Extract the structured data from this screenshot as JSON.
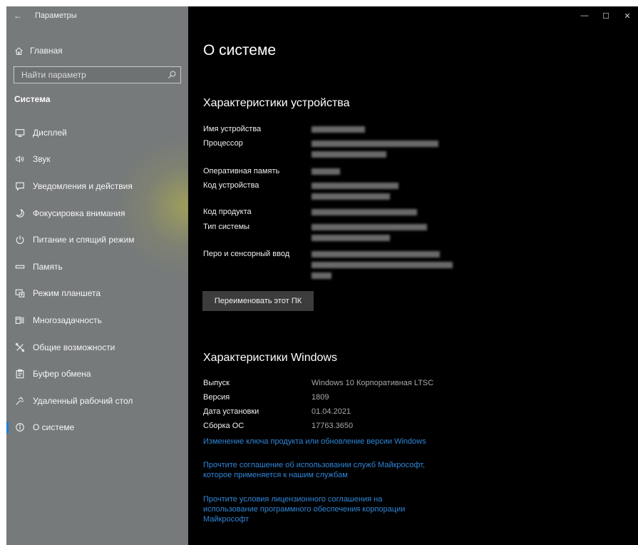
{
  "window": {
    "title": "Параметры",
    "controls": [
      "minimize",
      "maximize",
      "close"
    ]
  },
  "sidebar": {
    "home_label": "Главная",
    "search_placeholder": "Найти параметр",
    "section_title": "Система",
    "items": [
      {
        "label": "Дисплей",
        "icon": "display-icon"
      },
      {
        "label": "Звук",
        "icon": "sound-icon"
      },
      {
        "label": "Уведомления и действия",
        "icon": "notifications-icon"
      },
      {
        "label": "Фокусировка внимания",
        "icon": "focus-moon-icon"
      },
      {
        "label": "Питание и спящий режим",
        "icon": "power-icon"
      },
      {
        "label": "Память",
        "icon": "storage-icon"
      },
      {
        "label": "Режим планшета",
        "icon": "tablet-mode-icon"
      },
      {
        "label": "Многозадачность",
        "icon": "multitasking-icon"
      },
      {
        "label": "Общие возможности",
        "icon": "shared-experiences-icon"
      },
      {
        "label": "Буфер обмена",
        "icon": "clipboard-icon"
      },
      {
        "label": "Удаленный рабочий стол",
        "icon": "remote-desktop-icon"
      },
      {
        "label": "О системе",
        "icon": "info-icon",
        "active": true
      }
    ]
  },
  "main": {
    "page_title": "О системе",
    "device_specs": {
      "heading": "Характеристики устройства",
      "labels": {
        "device_name": "Имя устройства",
        "processor": "Процессор",
        "ram": "Оперативная память",
        "device_id": "Код устройства",
        "product_id": "Код продукта",
        "system_type": "Тип системы",
        "pen_touch": "Перо и сенсорный ввод"
      },
      "rename_button": "Переименовать этот ПК"
    },
    "windows_specs": {
      "heading": "Характеристики Windows",
      "edition_label": "Выпуск",
      "edition_value": "Windows 10 Корпоративная LTSC",
      "version_label": "Версия",
      "version_value": "1809",
      "install_date_label": "Дата установки",
      "install_date_value": "01.04.2021",
      "os_build_label": "Сборка ОС",
      "os_build_value": "17763.3650"
    },
    "links": {
      "change_key": "Изменение ключа продукта или обновление версии Windows",
      "services_agreement_1": "Прочтите соглашение об использовании служб Майкрософт,",
      "services_agreement_2": "которое применяется к нашим службам",
      "license_terms_1": "Прочтите условия лицензионного соглашения на",
      "license_terms_2": "использование программного обеспечения корпорации",
      "license_terms_3": "Майкрософт"
    }
  },
  "colors": {
    "sidebar_bg": "#767a7a",
    "main_bg": "#000000",
    "accent_link": "#2f86d8",
    "active_indicator": "#1a7fd6",
    "button_bg": "#3c3c3c"
  }
}
